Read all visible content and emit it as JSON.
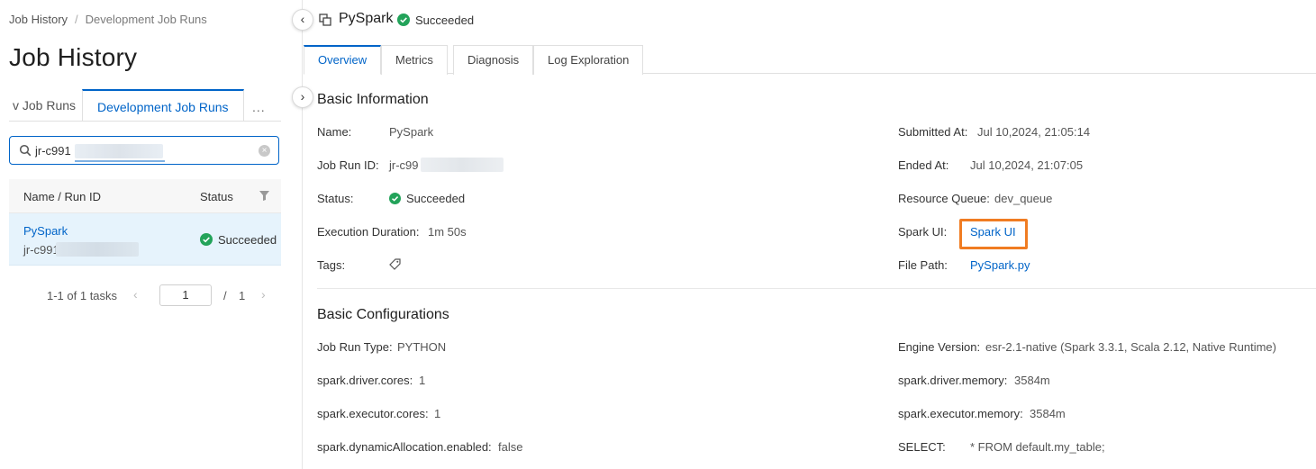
{
  "breadcrumb": {
    "root": "Job History",
    "separator": "/",
    "current": "Development Job Runs"
  },
  "page_title": "Job History",
  "left_tabs": {
    "partial": "v Job Runs",
    "active": "Development Job Runs",
    "more": "..."
  },
  "search": {
    "value": "jr-c991",
    "clear": "×"
  },
  "table": {
    "headers": {
      "name": "Name / Run ID",
      "status": "Status"
    },
    "rows": [
      {
        "name": "PySpark",
        "run_id": "jr-c991",
        "status": "Succeeded"
      }
    ]
  },
  "pager": {
    "total": "1-1 of 1 tasks",
    "prev": "‹",
    "current_page": "1",
    "slash": "/",
    "last_page": "1",
    "next": "›"
  },
  "collapse": {
    "left": "‹",
    "right": "›"
  },
  "detail": {
    "title": "PySpark",
    "status": "Succeeded",
    "tabs": [
      "Overview",
      "Metrics",
      "Diagnosis",
      "Log Exploration"
    ],
    "active_tab": "Overview"
  },
  "basic_info": {
    "title": "Basic Information",
    "name_label": "Name:",
    "name_value": "PySpark",
    "run_id_label": "Job Run ID:",
    "run_id_value": "jr-c99",
    "status_label": "Status:",
    "status_value": "Succeeded",
    "duration_label": "Execution Duration:",
    "duration_value": "1m 50s",
    "tags_label": "Tags:",
    "submitted_label": "Submitted At:",
    "submitted_value": "Jul 10,2024, 21:05:14",
    "ended_label": "Ended At:",
    "ended_value": "Jul 10,2024, 21:07:05",
    "queue_label": "Resource Queue:",
    "queue_value": "dev_queue",
    "spark_ui_label": "Spark UI:",
    "spark_ui_value": "Spark UI",
    "file_path_label": "File Path:",
    "file_path_value": "PySpark.py"
  },
  "basic_config": {
    "title": "Basic Configurations",
    "run_type_label": "Job Run Type:",
    "run_type_value": "PYTHON",
    "driver_cores_label": "spark.driver.cores:",
    "driver_cores_value": "1",
    "executor_cores_label": "spark.executor.cores:",
    "executor_cores_value": "1",
    "dyn_alloc_label": "spark.dynamicAllocation.enabled:",
    "dyn_alloc_value": "false",
    "engine_label": "Engine Version:",
    "engine_value": "esr-2.1-native (Spark 3.3.1, Scala 2.12, Native Runtime)",
    "driver_mem_label": "spark.driver.memory:",
    "driver_mem_value": "3584m",
    "executor_mem_label": "spark.executor.memory:",
    "executor_mem_value": "3584m",
    "select_label": "SELECT:",
    "select_value": "* FROM default.my_table;"
  },
  "colors": {
    "accent": "#0064c8",
    "success": "#23a35a",
    "highlight_box": "#f07c22",
    "selected_row": "#e6f3fc"
  },
  "icons": {
    "search": "search-icon",
    "clear": "clear-icon",
    "filter": "filter-icon",
    "success": "check-circle-icon",
    "copy": "copy-icon",
    "tag": "tag-icon",
    "collapse_left": "chevron-left-icon",
    "collapse_right": "chevron-right-icon"
  }
}
